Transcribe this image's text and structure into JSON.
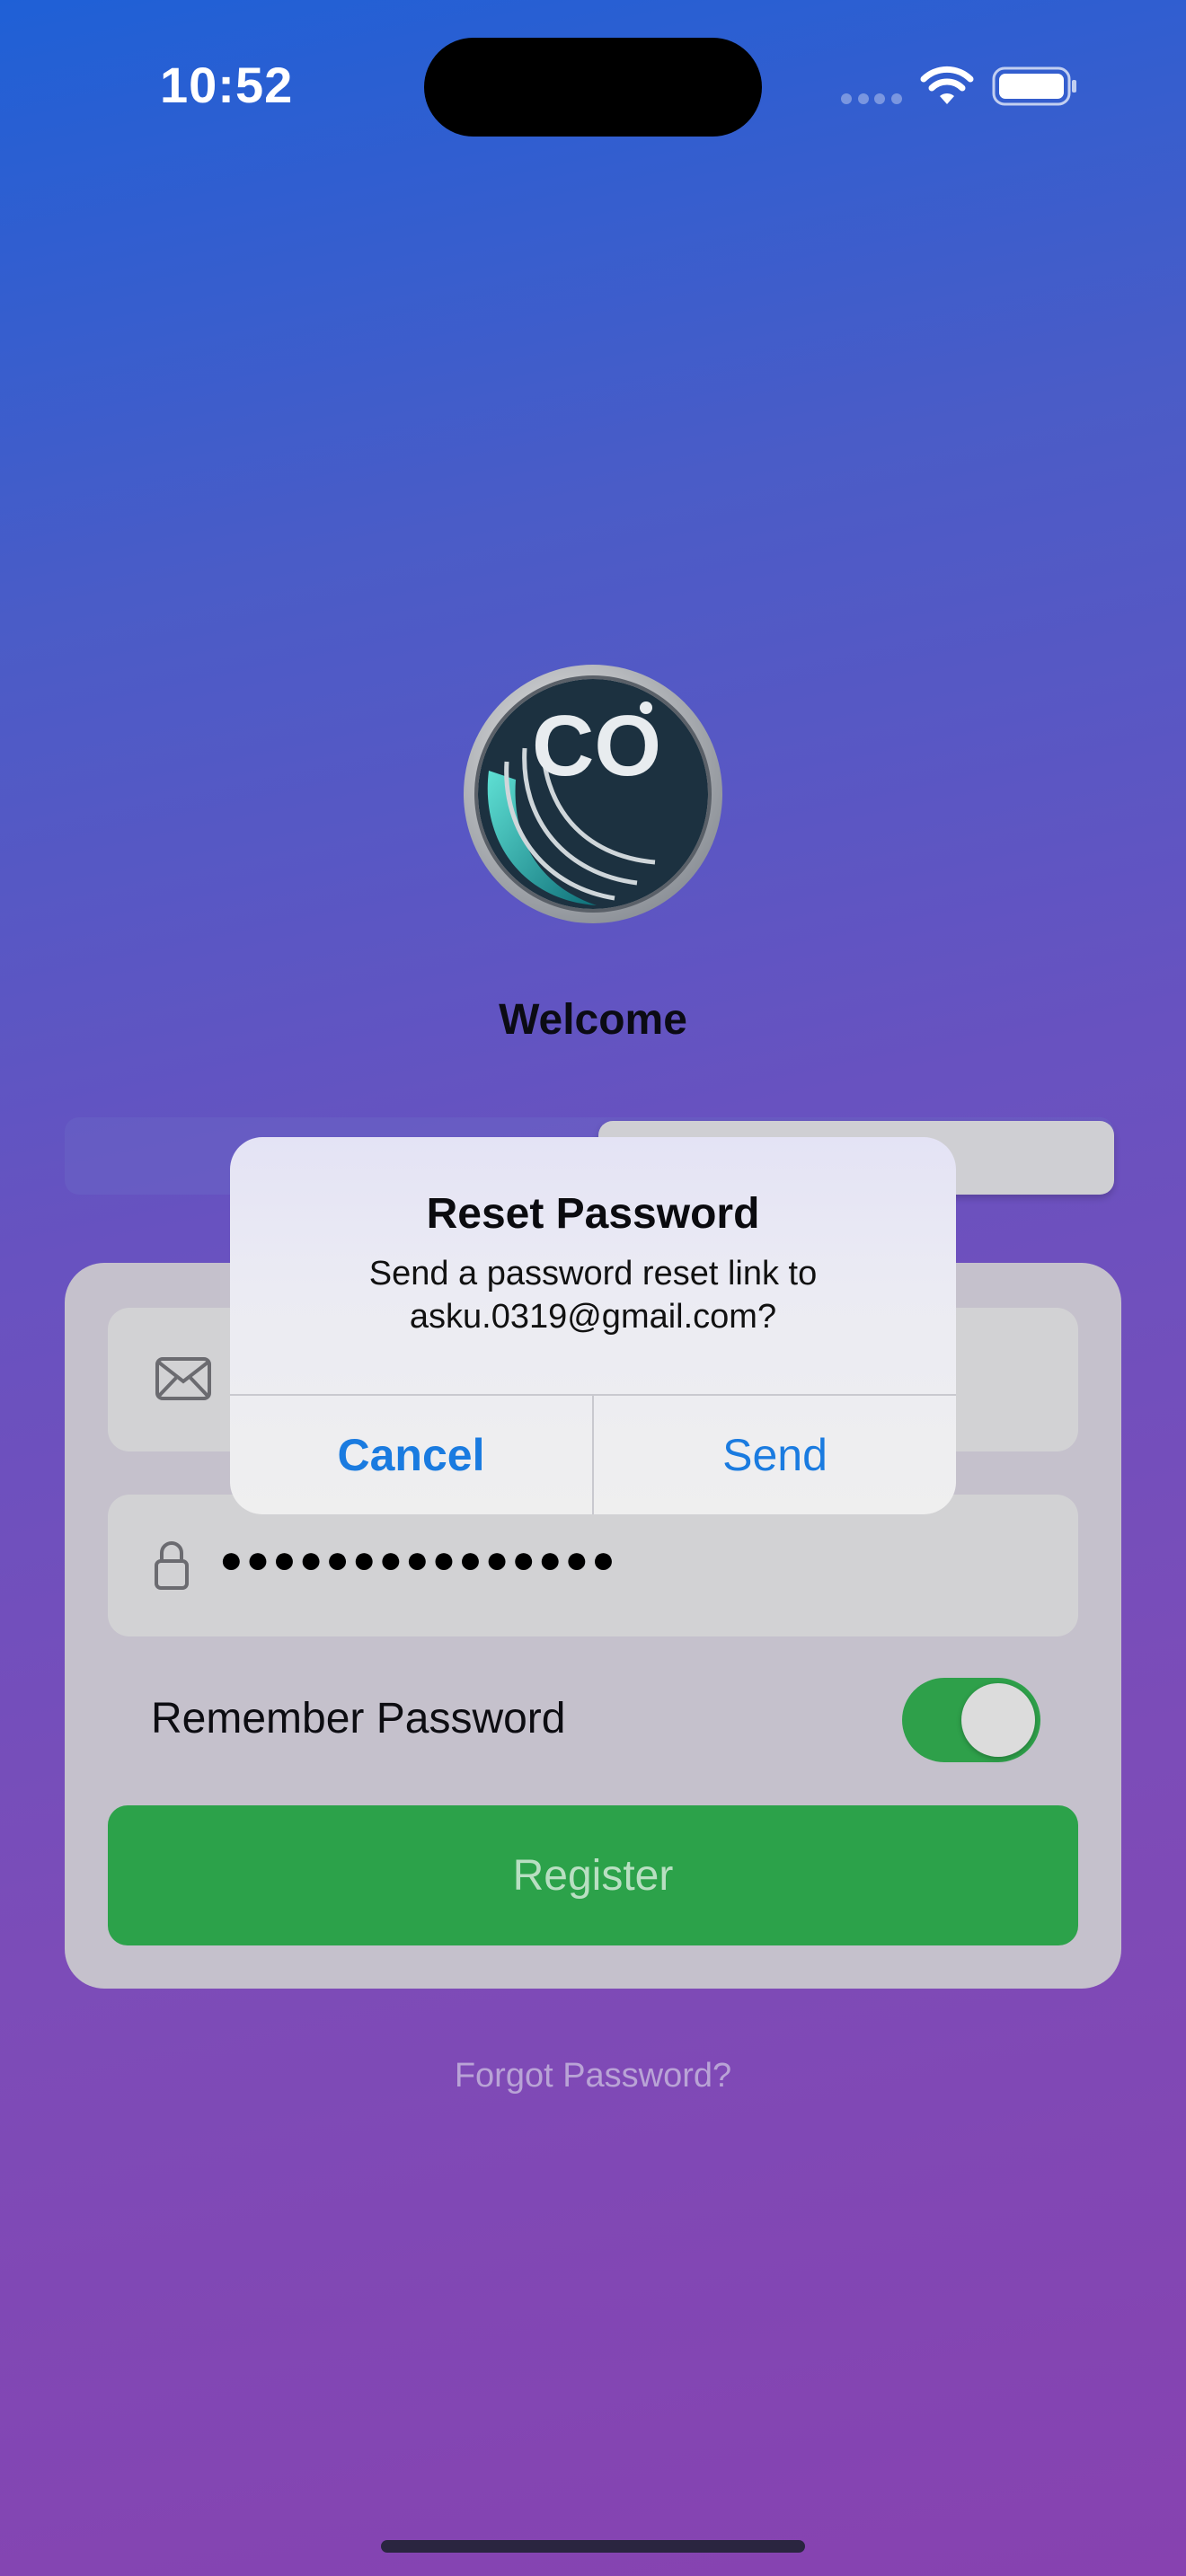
{
  "status_bar": {
    "time": "10:52",
    "wifi_icon": "wifi-icon",
    "battery_icon": "battery-icon",
    "cellular_icon": "cellular-dots-icon"
  },
  "logo": {
    "text": "CO",
    "icon": "app-logo-icon"
  },
  "welcome": "Welcome",
  "form": {
    "email_icon": "envelope-icon",
    "password_icon": "lock-icon",
    "password_value": "●●●●●●●●●●●●●●●",
    "remember_label": "Remember Password",
    "remember_on": true,
    "register_label": "Register",
    "forgot_label": "Forgot Password?"
  },
  "alert": {
    "title": "Reset Password",
    "message_line1": "Send a password reset link to",
    "message_line2": "asku.0319@gmail.com?",
    "cancel_label": "Cancel",
    "send_label": "Send"
  },
  "colors": {
    "accent_blue": "#1a7be0",
    "register_green": "#2ca24a",
    "toggle_green": "#2ea04a",
    "gradient_top": "#1f60d6",
    "gradient_bottom": "#8742b0"
  }
}
